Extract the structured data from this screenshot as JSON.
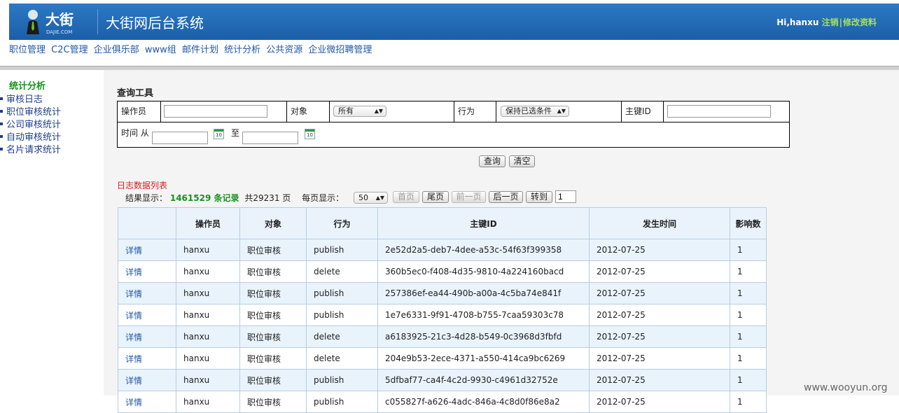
{
  "header": {
    "logo_text": "大街",
    "logo_sub": "DAJIE.COM",
    "app_title": "大街网后台系统",
    "greeting": "Hi,hanxu",
    "logout": "注销",
    "separator": "|",
    "edit_profile": "修改资料"
  },
  "topnav": [
    "职位管理",
    "C2C管理",
    "企业俱乐部",
    "www组",
    "邮件计划",
    "统计分析",
    "公共资源",
    "企业微招聘管理"
  ],
  "sidebar": {
    "title": "统计分析",
    "items": [
      "审核日志",
      "职位审核统计",
      "公司审核统计",
      "自动审核统计",
      "名片请求统计"
    ]
  },
  "query": {
    "title": "查询工具",
    "operator_label": "操作员",
    "operator_value": "",
    "object_label": "对象",
    "object_selected": "所有",
    "action_label": "行为",
    "action_selected": "保持已选条件",
    "key_label": "主键ID",
    "key_value": "",
    "time_label": "时间 从",
    "to_label": "至",
    "calendar_text": "10",
    "search_button": "查询",
    "clear_button": "清空"
  },
  "results": {
    "list_title": "日志数据列表",
    "prefix": "结果显示：",
    "count": "1461529 条记录",
    "pages": "共29231 页",
    "per_page_label": "每页显示：",
    "per_page_value": "50",
    "first": "首页",
    "last": "尾页",
    "prev": "前一页",
    "next": "后一页",
    "goto": "转到",
    "goto_value": "1"
  },
  "table": {
    "headers": [
      "",
      "操作员",
      "对象",
      "行为",
      "主键ID",
      "发生时间",
      "影响数"
    ],
    "rows": [
      [
        "详情",
        "hanxu",
        "职位审核",
        "publish",
        "2e52d2a5-deb7-4dee-a53c-54f63f399358",
        "2012-07-25",
        "1"
      ],
      [
        "详情",
        "hanxu",
        "职位审核",
        "delete",
        "360b5ec0-f408-4d35-9810-4a224160bacd",
        "2012-07-25",
        "1"
      ],
      [
        "详情",
        "hanxu",
        "职位审核",
        "publish",
        "257386ef-ea44-490b-a00a-4c5ba74e841f",
        "2012-07-25",
        "1"
      ],
      [
        "详情",
        "hanxu",
        "职位审核",
        "publish",
        "1e7e6331-9f91-4708-b755-7caa59303c78",
        "2012-07-25",
        "1"
      ],
      [
        "详情",
        "hanxu",
        "职位审核",
        "delete",
        "a6183925-21c3-4d28-b549-0c3968d3fbfd",
        "2012-07-25",
        "1"
      ],
      [
        "详情",
        "hanxu",
        "职位审核",
        "delete",
        "204e9b53-2ece-4371-a550-414ca9bc6269",
        "2012-07-25",
        "1"
      ],
      [
        "详情",
        "hanxu",
        "职位审核",
        "publish",
        "5dfbaf77-ca4f-4c2d-9930-c4961d32752e",
        "2012-07-25",
        "1"
      ],
      [
        "详情",
        "hanxu",
        "职位审核",
        "publish",
        "c055827f-a626-4adc-846a-4c8d0f86e8a2",
        "2012-07-25",
        "1"
      ]
    ]
  },
  "watermark": "www.wooyun.org"
}
